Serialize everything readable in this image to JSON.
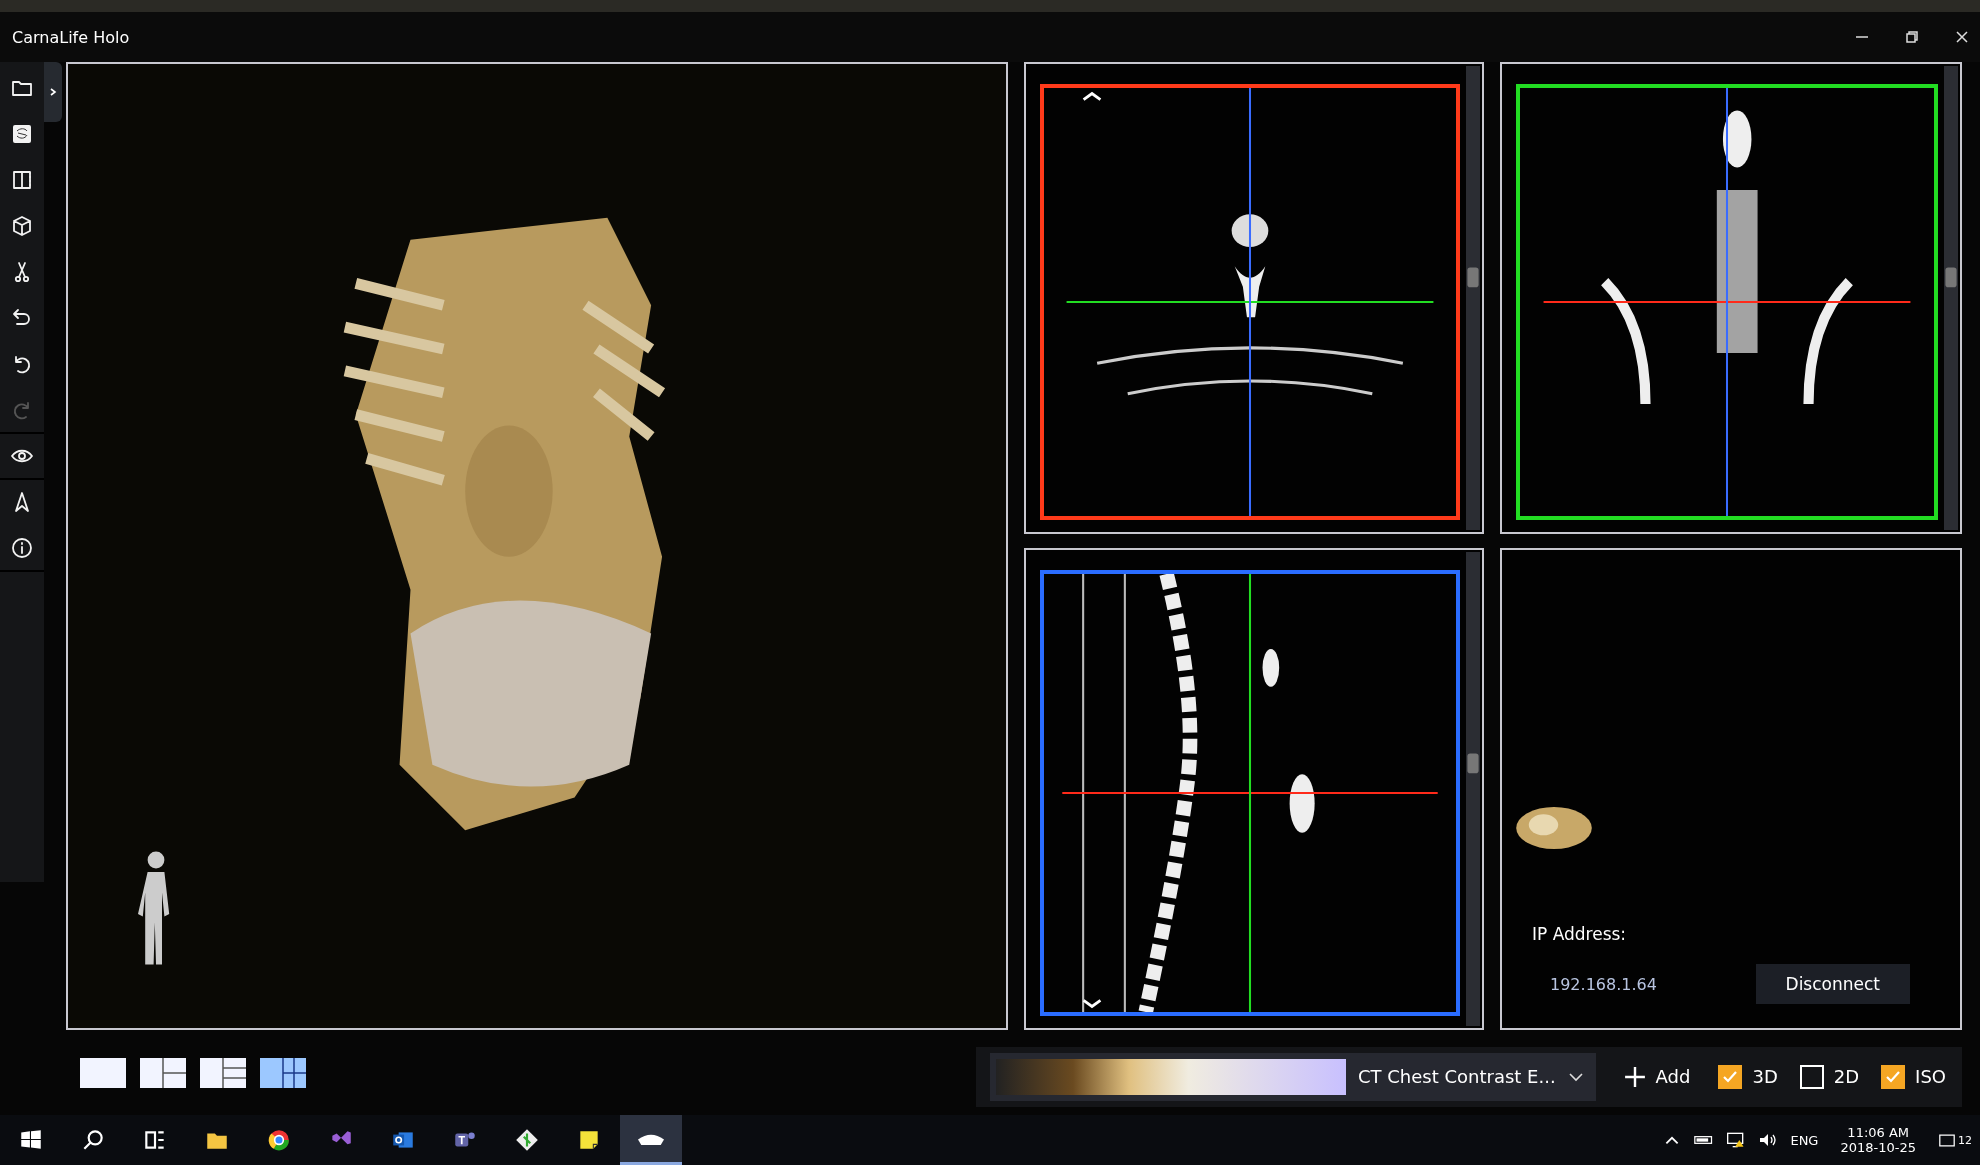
{
  "window": {
    "title": "CarnaLife Holo"
  },
  "toolbar": {
    "groups": [
      [
        {
          "kind": "folder",
          "disabled": false
        },
        {
          "kind": "image",
          "disabled": false
        },
        {
          "kind": "split",
          "disabled": false
        },
        {
          "kind": "cube",
          "disabled": false
        },
        {
          "kind": "scissors",
          "disabled": false
        },
        {
          "kind": "undo",
          "disabled": false
        },
        {
          "kind": "rotate",
          "disabled": false
        },
        {
          "kind": "redo",
          "disabled": true
        }
      ],
      [
        {
          "kind": "eye",
          "disabled": false
        }
      ],
      [
        {
          "kind": "navigate",
          "disabled": false
        },
        {
          "kind": "info",
          "disabled": false
        }
      ]
    ]
  },
  "views": [
    {
      "kind": "volume"
    },
    {
      "kind": "axial",
      "color": "#ff3a1a"
    },
    {
      "kind": "coronal",
      "color": "#22dd22"
    },
    {
      "kind": "sagittal",
      "color": "#2a6cff"
    },
    {
      "kind": "remote",
      "ip_label": "IP Address:",
      "ip_value": "192.168.1.64",
      "button": "Disconnect"
    }
  ],
  "layouts": [
    {
      "kind": "single",
      "selected": false
    },
    {
      "kind": "two",
      "selected": false
    },
    {
      "kind": "three",
      "selected": false
    },
    {
      "kind": "four",
      "selected": true
    }
  ],
  "controls": {
    "preset": "CT Chest Contrast E...",
    "add": "Add",
    "toggles": [
      {
        "label": "3D",
        "checked": true
      },
      {
        "label": "2D",
        "checked": false
      },
      {
        "label": "ISO",
        "checked": true
      }
    ]
  },
  "taskbar": {
    "apps": [
      {
        "kind": "start",
        "selected": false
      },
      {
        "kind": "search",
        "selected": false
      },
      {
        "kind": "taskview",
        "selected": false
      },
      {
        "kind": "folder",
        "selected": false
      },
      {
        "kind": "browser",
        "selected": false
      },
      {
        "kind": "studio",
        "selected": false
      },
      {
        "kind": "mail",
        "selected": false
      },
      {
        "kind": "chat",
        "selected": false
      },
      {
        "kind": "git",
        "selected": false
      },
      {
        "kind": "note",
        "selected": false
      },
      {
        "kind": "headset",
        "selected": true
      }
    ],
    "language": "ENG",
    "time": "11:06 AM",
    "date": "2018-10-25",
    "notifications": "12"
  }
}
